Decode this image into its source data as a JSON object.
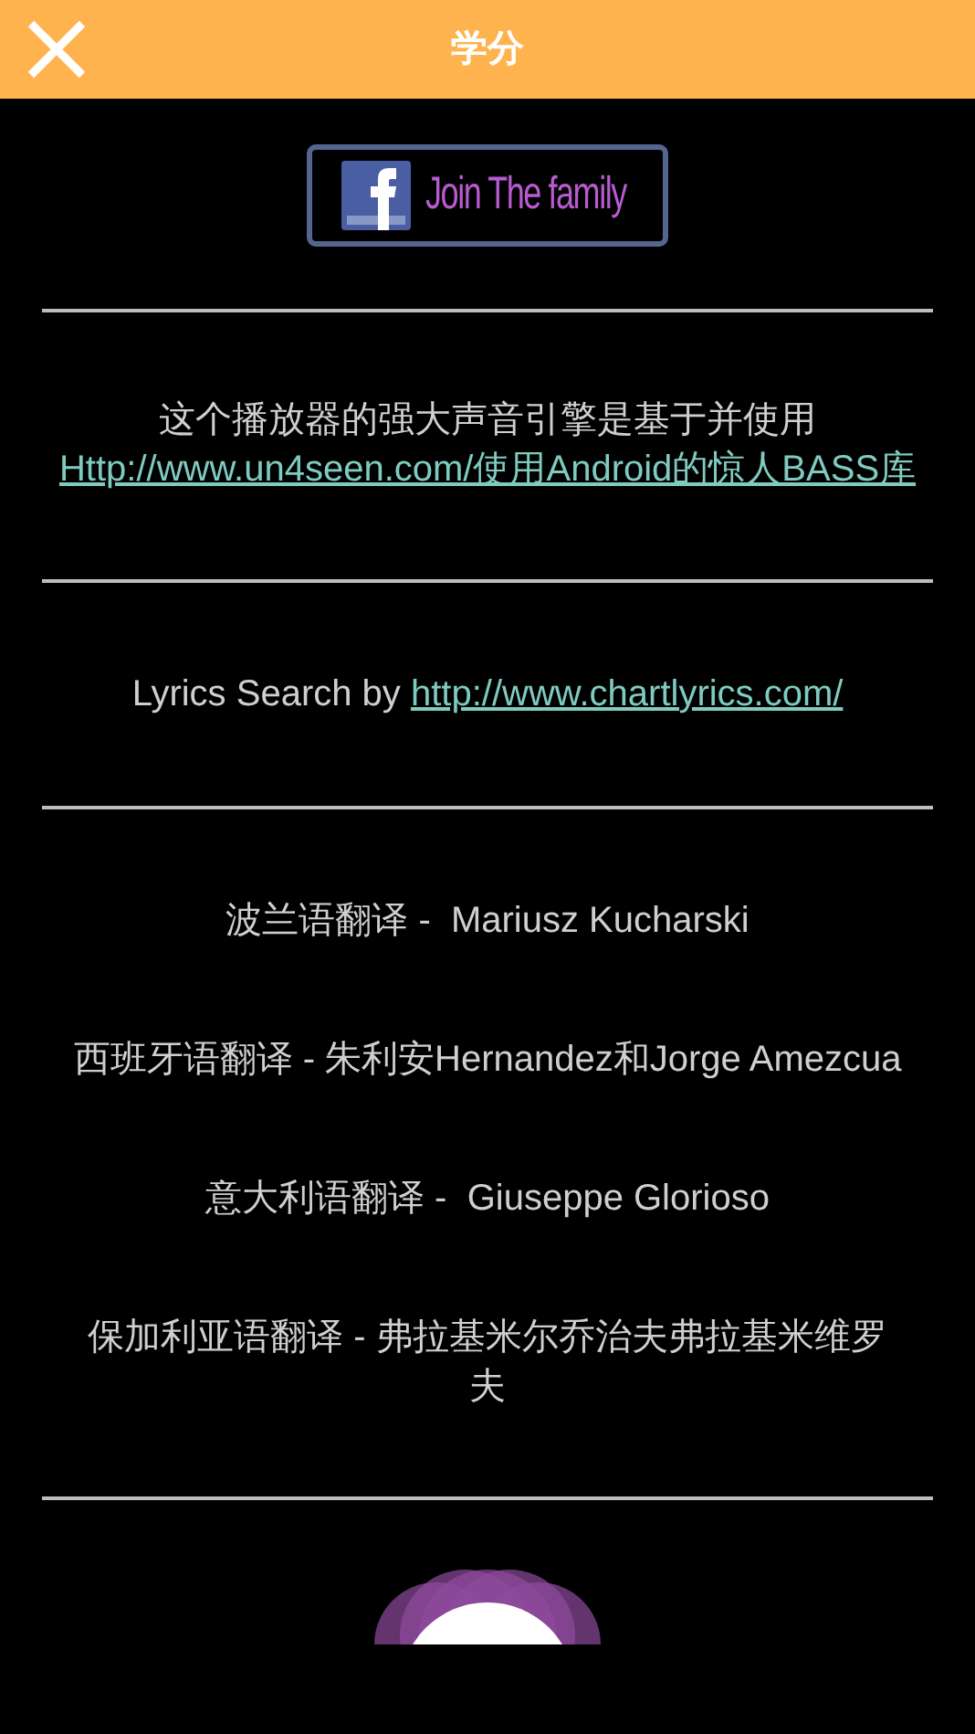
{
  "header": {
    "title": "学分"
  },
  "facebook_button": {
    "label": "Join The family"
  },
  "engine_note": {
    "text": "这个播放器的强大声音引擎是基于并使用",
    "link": "Http://www.un4seen.com/使用Android的惊人BASS库"
  },
  "lyrics_note": {
    "text": "Lyrics Search by ",
    "link": "http://www.chartlyrics.com/"
  },
  "translations": [
    {
      "text": "波兰语翻译 -  Mariusz Kucharski"
    },
    {
      "text": "西班牙语翻译 - 朱利安Hernandez和Jorge Amezcua"
    },
    {
      "text": "意大利语翻译 -  Giuseppe Glorioso"
    },
    {
      "text": "保加利亚语翻译 - 弗拉基米尔乔治夫弗拉基米维罗夫"
    }
  ]
}
